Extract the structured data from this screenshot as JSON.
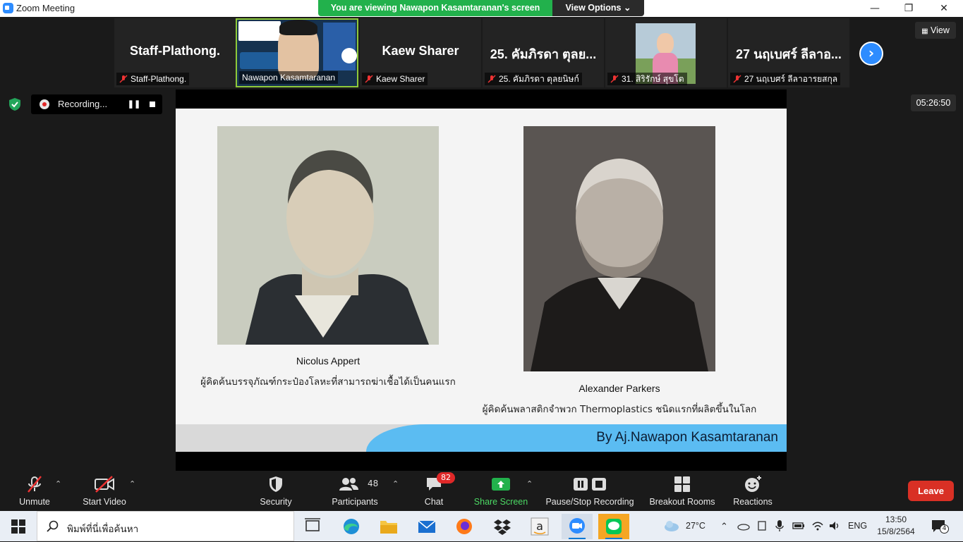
{
  "window": {
    "title": "Zoom Meeting"
  },
  "banner": {
    "viewing_text": "You are viewing Nawapon Kasamtaranan's screen",
    "view_options": "View Options ⌄"
  },
  "view_button": "View",
  "thumbnails": [
    {
      "big": "Staff-Plathong.",
      "name": "Staff-Plathong."
    },
    {
      "big": "",
      "name": "Nawapon Kasamtaranan"
    },
    {
      "big": "Kaew Sharer",
      "name": "Kaew Sharer"
    },
    {
      "big": "25. คัมภิรดา ตุลย...",
      "name": "25. คัมภิรดา ตุลยนิษก์"
    },
    {
      "big": "",
      "name": "31. สิริรักษ์ สุขโต"
    },
    {
      "big": "27 นฤเบศร์ ลีลาอ...",
      "name": "27 นฤเบศร์ ลีลาอารยสกุล"
    }
  ],
  "recording": {
    "label": "Recording...",
    "pause": "❚❚"
  },
  "timer": "05:26:50",
  "slide": {
    "left_name": "Nicolus Appert",
    "left_desc": "ผู้คิดค้นบรรจุภัณฑ์กระป๋องโลหะที่สามารถฆ่าเชื้อได้เป็นคนแรก",
    "right_name": "Alexander Parkers",
    "right_desc": "ผู้คิดค้นพลาสติกจำพวก Thermoplastics ชนิดแรกที่ผลิตขึ้นในโลก",
    "byline": "By Aj.Nawapon Kasamtaranan"
  },
  "toolbar": {
    "unmute": "Unmute",
    "start_video": "Start Video",
    "security": "Security",
    "participants": "Participants",
    "participants_count": "48",
    "chat": "Chat",
    "chat_badge": "82",
    "share_screen": "Share Screen",
    "pause_stop_recording": "Pause/Stop Recording",
    "breakout_rooms": "Breakout Rooms",
    "reactions": "Reactions",
    "leave": "Leave"
  },
  "taskbar": {
    "search_placeholder": "พิมพ์ที่นี่เพื่อค้นหา",
    "weather": "27°C",
    "language": "ENG",
    "time": "13:50",
    "date": "15/8/2564",
    "notifications": "4"
  },
  "colors": {
    "zoom_blue": "#2D8CFF",
    "share_green": "#22B14C",
    "leave_red": "#D93025",
    "slide_footer_blue": "#5BBCF2"
  }
}
